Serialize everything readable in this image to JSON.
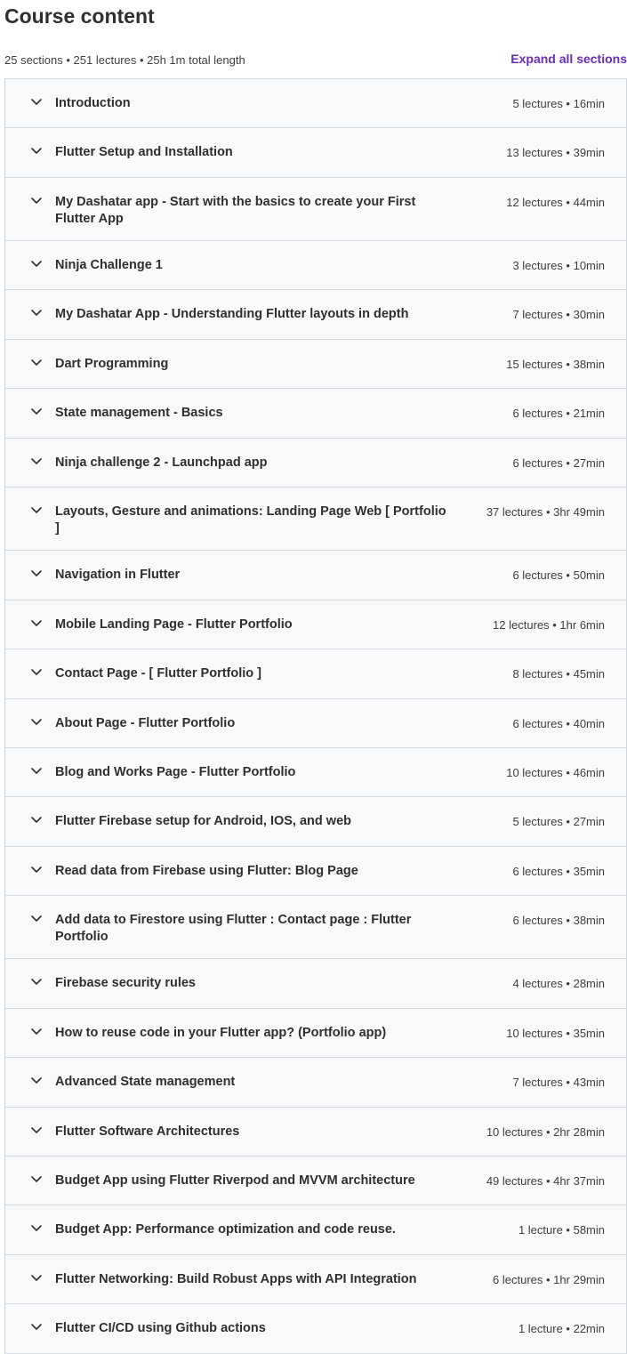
{
  "header": {
    "title": "Course content",
    "summary": "25 sections • 251 lectures • 25h 1m total length",
    "expand_label": "Expand all sections"
  },
  "icons": {
    "section_toggle": "chevron-down-icon"
  },
  "colors": {
    "accent": "#6a2bbf",
    "row_bg": "#f7f9fa",
    "border": "#d1d7dc"
  },
  "sections": [
    {
      "title": "Introduction",
      "meta": "5 lectures • 16min"
    },
    {
      "title": "Flutter Setup and Installation",
      "meta": "13 lectures • 39min"
    },
    {
      "title": "My Dashatar app - Start with the basics to create your First Flutter App",
      "meta": "12 lectures • 44min"
    },
    {
      "title": "Ninja Challenge 1",
      "meta": "3 lectures • 10min"
    },
    {
      "title": "My Dashatar App - Understanding Flutter layouts in depth",
      "meta": "7 lectures • 30min"
    },
    {
      "title": "Dart Programming",
      "meta": "15 lectures • 38min"
    },
    {
      "title": "State management - Basics",
      "meta": "6 lectures • 21min"
    },
    {
      "title": "Ninja challenge 2 - Launchpad app",
      "meta": "6 lectures • 27min"
    },
    {
      "title": "Layouts, Gesture and animations: Landing Page Web [ Portfolio ]",
      "meta": "37 lectures • 3hr 49min"
    },
    {
      "title": "Navigation in Flutter",
      "meta": "6 lectures • 50min"
    },
    {
      "title": "Mobile Landing Page - Flutter Portfolio",
      "meta": "12 lectures • 1hr 6min"
    },
    {
      "title": "Contact Page - [ Flutter Portfolio ]",
      "meta": "8 lectures • 45min"
    },
    {
      "title": "About Page - Flutter Portfolio",
      "meta": "6 lectures • 40min"
    },
    {
      "title": "Blog and Works Page - Flutter Portfolio",
      "meta": "10 lectures • 46min"
    },
    {
      "title": "Flutter Firebase setup for Android, IOS, and web",
      "meta": "5 lectures • 27min"
    },
    {
      "title": "Read data from Firebase using Flutter: Blog Page",
      "meta": "6 lectures • 35min"
    },
    {
      "title": "Add data to Firestore using Flutter : Contact page : Flutter Portfolio",
      "meta": "6 lectures • 38min"
    },
    {
      "title": "Firebase security rules",
      "meta": "4 lectures • 28min"
    },
    {
      "title": "How to reuse code in your Flutter app? (Portfolio app)",
      "meta": "10 lectures • 35min"
    },
    {
      "title": "Advanced State management",
      "meta": "7 lectures • 43min"
    },
    {
      "title": "Flutter Software Architectures",
      "meta": "10 lectures • 2hr 28min"
    },
    {
      "title": "Budget App using Flutter Riverpod and MVVM architecture",
      "meta": "49 lectures • 4hr 37min"
    },
    {
      "title": "Budget App: Performance optimization and code reuse.",
      "meta": "1 lecture • 58min"
    },
    {
      "title": "Flutter Networking: Build Robust Apps with API Integration",
      "meta": "6 lectures • 1hr 29min"
    },
    {
      "title": "Flutter CI/CD using Github actions",
      "meta": "1 lecture • 22min"
    }
  ]
}
